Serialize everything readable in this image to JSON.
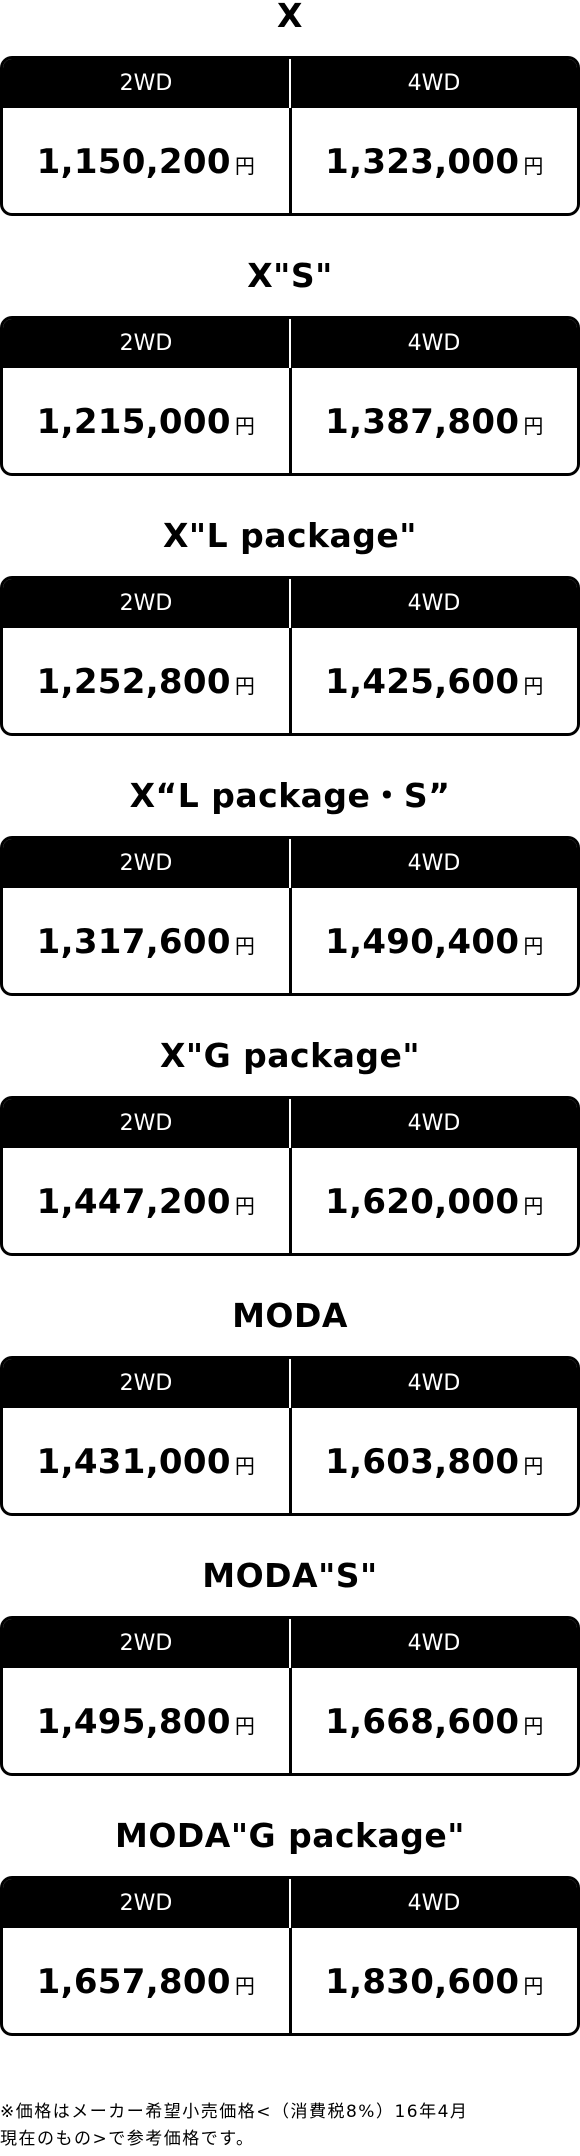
{
  "drive_labels": [
    "2WD",
    "4WD"
  ],
  "currency_symbol": "円",
  "grades": [
    {
      "name": "X",
      "prices": [
        "1,150,200",
        "1,323,000"
      ]
    },
    {
      "name": "X\"S\"",
      "prices": [
        "1,215,000",
        "1,387,800"
      ]
    },
    {
      "name": "X\"L package\"",
      "prices": [
        "1,252,800",
        "1,425,600"
      ]
    },
    {
      "name": "X“L package・S”",
      "prices": [
        "1,317,600",
        "1,490,400"
      ]
    },
    {
      "name": "X\"G package\"",
      "prices": [
        "1,447,200",
        "1,620,000"
      ]
    },
    {
      "name": "MODA",
      "prices": [
        "1,431,000",
        "1,603,800"
      ]
    },
    {
      "name": "MODA\"S\"",
      "prices": [
        "1,495,800",
        "1,668,600"
      ]
    },
    {
      "name": "MODA\"G package\"",
      "prices": [
        "1,657,800",
        "1,830,600"
      ]
    }
  ],
  "footnote": {
    "line1": "※価格はメーカー希望小売価格<（消費税8%）16年4月",
    "line2": "現在のもの>で参考価格です。"
  }
}
